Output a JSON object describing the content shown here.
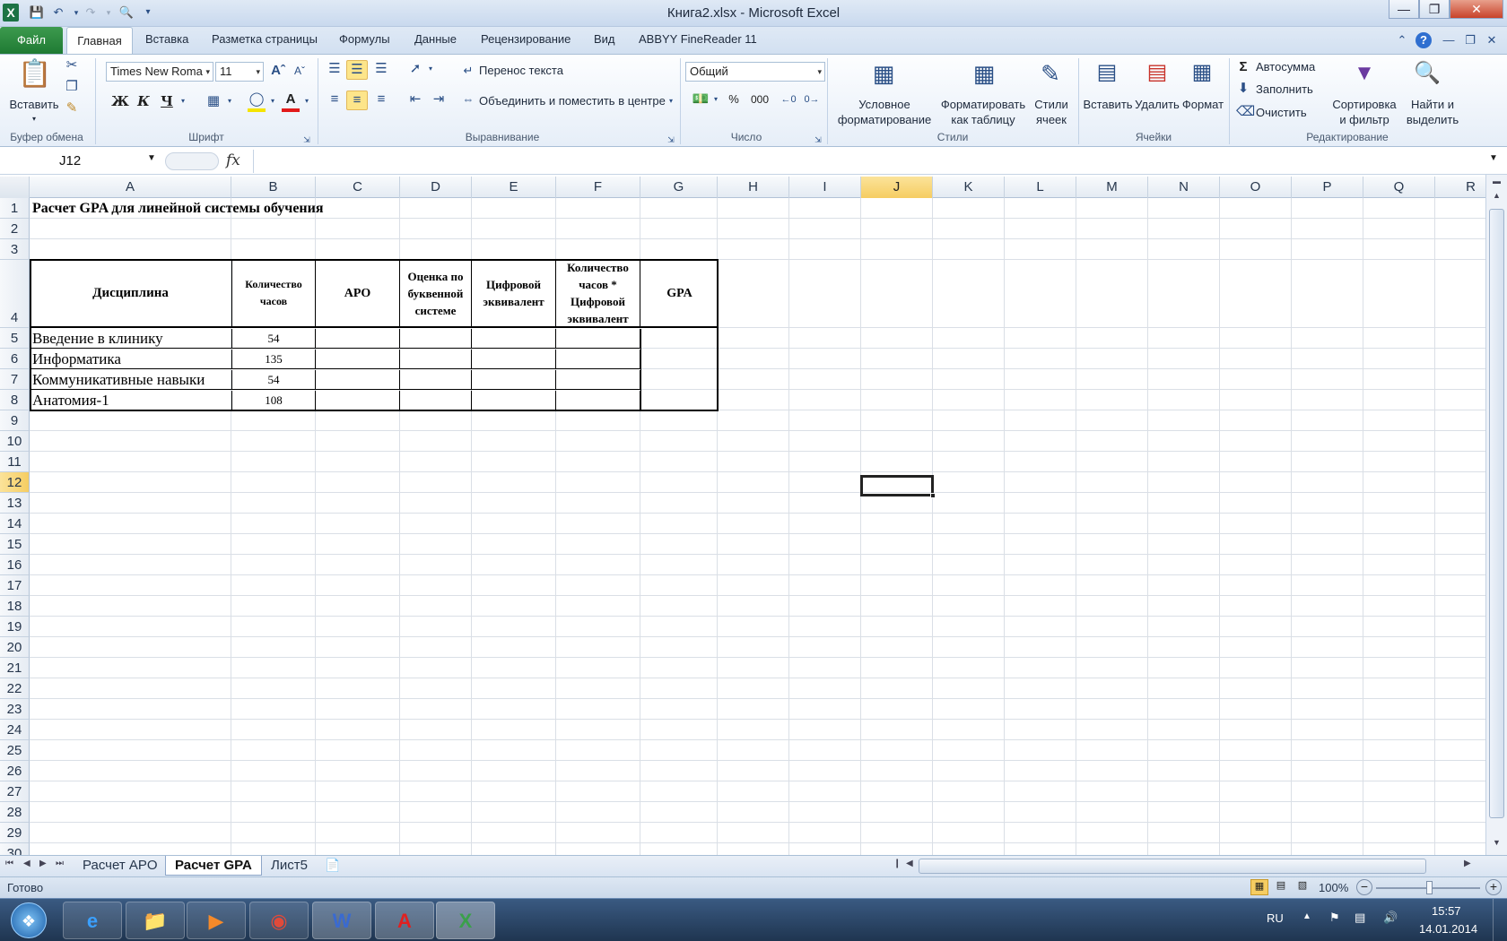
{
  "window": {
    "title": "Книга2.xlsx - Microsoft Excel",
    "app_icon": "X"
  },
  "qat": {
    "save_icon": "save-icon",
    "undo_icon": "undo-icon",
    "redo_icon": "redo-icon",
    "print_preview_icon": "print-preview-icon"
  },
  "tabs": {
    "file": "Файл",
    "items": [
      "Главная",
      "Вставка",
      "Разметка страницы",
      "Формулы",
      "Данные",
      "Рецензирование",
      "Вид",
      "ABBYY FineReader 11"
    ]
  },
  "ribbon": {
    "clipboard": {
      "paste": "Вставить",
      "label": "Буфер обмена"
    },
    "font": {
      "name": "Times New Roma",
      "size": "11",
      "bold": "Ж",
      "italic": "К",
      "underline": "Ч",
      "label": "Шрифт"
    },
    "alignment": {
      "wrap": "Перенос текста",
      "merge": "Объединить и поместить в центре",
      "label": "Выравнивание"
    },
    "number": {
      "format": "Общий",
      "percent": "%",
      "thousands": "000",
      "label": "Число"
    },
    "styles": {
      "conditional_1": "Условное",
      "conditional_2": "форматирование",
      "table_1": "Форматировать",
      "table_2": "как таблицу",
      "cell_1": "Стили",
      "cell_2": "ячеек",
      "label": "Стили"
    },
    "cells": {
      "insert": "Вставить",
      "delete": "Удалить",
      "format": "Формат",
      "label": "Ячейки"
    },
    "editing": {
      "autosum": "Автосумма",
      "fill": "Заполнить",
      "clear": "Очистить",
      "sort_1": "Сортировка",
      "sort_2": "и фильтр",
      "find_1": "Найти и",
      "find_2": "выделить",
      "label": "Редактирование"
    }
  },
  "formula_bar": {
    "name_box": "J12",
    "fx": "fx",
    "value": ""
  },
  "columns": [
    "A",
    "B",
    "C",
    "D",
    "E",
    "F",
    "G",
    "H",
    "I",
    "J",
    "K",
    "L",
    "M",
    "N",
    "O",
    "P",
    "Q",
    "R"
  ],
  "rows": [
    "1",
    "2",
    "3",
    "4",
    "5",
    "6",
    "7",
    "8",
    "9",
    "10",
    "11",
    "12",
    "13",
    "14",
    "15",
    "16",
    "17",
    "18",
    "19",
    "20",
    "21",
    "22",
    "23",
    "24",
    "25",
    "26",
    "27",
    "28",
    "29",
    "30"
  ],
  "sheet": {
    "title": "Расчет GPA для линейной системы обучения",
    "headers": [
      "Дисциплина",
      "Количество часов",
      "APO",
      "Оценка по буквенной системе",
      "Цифровой эквивалент",
      "Количество часов * Цифровой эквивалент",
      "GPA"
    ],
    "disciplines": [
      {
        "name": "Введение в клинику",
        "hours": "54"
      },
      {
        "name": "Информатика",
        "hours": "135"
      },
      {
        "name": "Коммуникативные навыки",
        "hours": "54"
      },
      {
        "name": "Анатомия-1",
        "hours": "108"
      }
    ]
  },
  "sheet_tabs": [
    "Расчет APO",
    "Расчет GPA",
    "Лист5"
  ],
  "status": {
    "ready": "Готово",
    "zoom": "100%"
  },
  "taskbar": {
    "lang": "RU",
    "time": "15:57",
    "date": "14.01.2014"
  }
}
